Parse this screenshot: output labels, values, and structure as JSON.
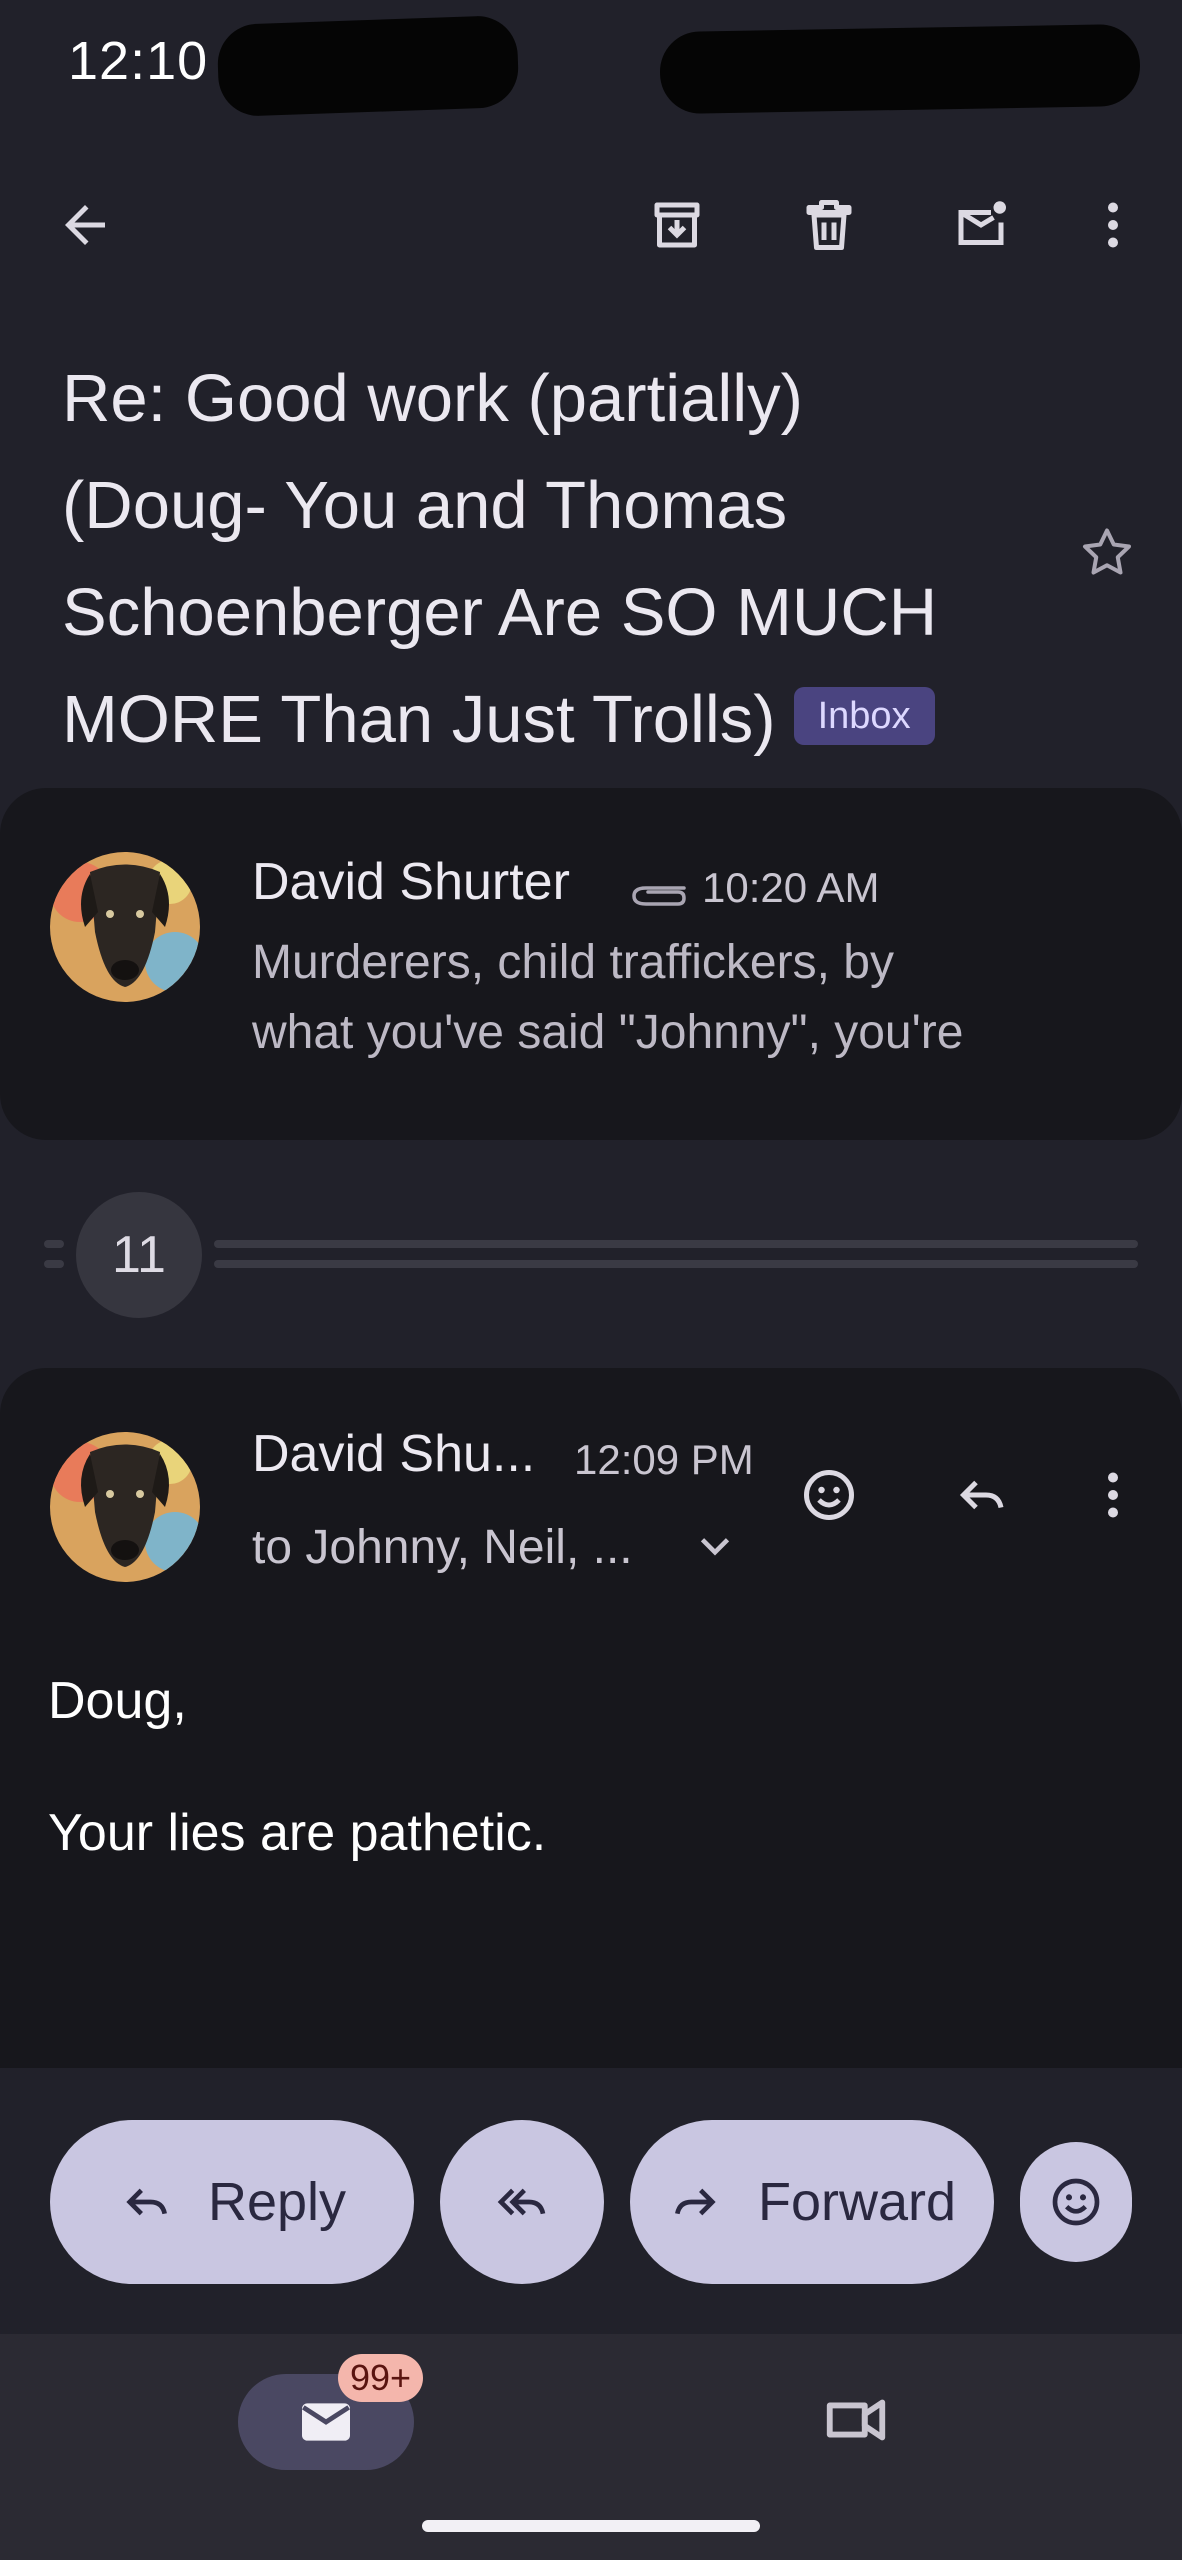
{
  "status_bar": {
    "time": "12:10"
  },
  "top_bar": {
    "back_icon": "arrow-back-icon",
    "archive_icon": "archive-icon",
    "delete_icon": "delete-icon",
    "mark_unread_icon": "mark-unread-icon",
    "more_icon": "more-vert-icon"
  },
  "subject": {
    "lines": [
      "Re: Good work (partially)",
      "(Doug- You and Thomas",
      "Schoenberger Are SO MUCH",
      "MORE Than Just Trolls)"
    ],
    "label": "Inbox",
    "star_icon": "star-outline-icon"
  },
  "messages": {
    "collapsed": {
      "sender": "David Shurter",
      "attachment_icon": "paperclip-icon",
      "time": "10:20 AM",
      "snippet_lines": [
        "Murderers, child traffickers, by",
        "what you've said \"Johnny\", you're"
      ]
    },
    "hidden_count": "11",
    "expanded": {
      "sender": "David Shu...",
      "time": "12:09 PM",
      "recipients": "to Johnny, Neil, ...",
      "body": [
        "Doug,",
        "Your lies are pathetic."
      ]
    }
  },
  "actions": {
    "reply": "Reply",
    "forward": "Forward",
    "reply_all_icon": "reply-all-icon",
    "emoji_icon": "add-reaction-icon"
  },
  "bottom_nav": {
    "mail_badge": "99+",
    "mail_icon": "mail-icon",
    "meet_icon": "videocam-icon"
  },
  "colors": {
    "background": "#21212a",
    "card": "#17171c",
    "chip": "#4a4480",
    "pill": "#c9c6e1",
    "badge": "#f4b6ac"
  }
}
